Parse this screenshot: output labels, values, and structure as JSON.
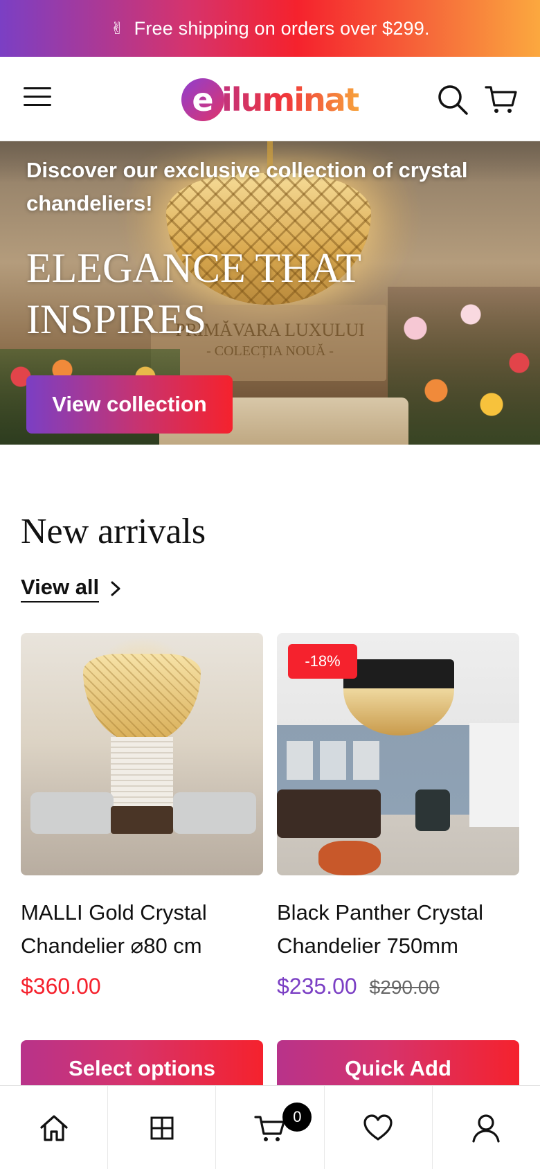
{
  "announcement": {
    "icon": "victory-hand-icon",
    "text": "Free shipping on orders over $299."
  },
  "header": {
    "logo_mark": "e",
    "logo_text": "iluminat",
    "icons": [
      "menu-icon",
      "search-icon",
      "cart-icon"
    ]
  },
  "hero": {
    "subtitle": "Discover our exclusive collection of crystal chandeliers!",
    "title_line1": "ELEGANCE THAT",
    "title_line2": "INSPIRES",
    "button_label": "View collection",
    "image_text_1": "PRIMĂVARA LUXULUI",
    "image_text_2": "- COLECȚIA NOUĂ -"
  },
  "new_arrivals": {
    "title": "New arrivals",
    "view_all_label": "View all",
    "products": [
      {
        "title_line1": "MALLI Gold Crystal",
        "title_line2": "Chandelier ⌀80 cm",
        "price": "$360.00",
        "button_label": "Select options"
      },
      {
        "badge": "-18%",
        "title_line1": "Black Panther Crystal",
        "title_line2": "Chandelier 750mm",
        "price": "$235.00",
        "compare_price": "$290.00",
        "button_label": "Quick Add"
      }
    ]
  },
  "bottom_nav": {
    "items": [
      "home-icon",
      "collections-grid-icon",
      "cart-icon",
      "wishlist-heart-icon",
      "account-icon"
    ],
    "cart_count": "0"
  },
  "colors": {
    "brand_purple": "#7b3fc4",
    "brand_red": "#f5222d",
    "brand_orange": "#fba83f",
    "sale_price": "#7b3fc4",
    "regular_price": "#f5222d"
  }
}
